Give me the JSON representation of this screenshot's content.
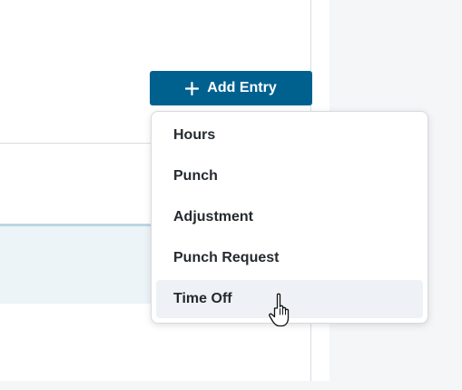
{
  "toolbar": {
    "add_entry_label": "Add Entry"
  },
  "menu": {
    "items": [
      {
        "label": "Hours"
      },
      {
        "label": "Punch"
      },
      {
        "label": "Adjustment"
      },
      {
        "label": "Punch Request"
      },
      {
        "label": "Time Off"
      }
    ],
    "hovered_item": "Time Off"
  },
  "icons": {
    "add": "plus-icon",
    "pointer": "hand-pointer-cursor-icon"
  },
  "colors": {
    "accent": "#00618f",
    "selected_row": "#ecf4f8",
    "menu_hover": "#eef2f6"
  }
}
